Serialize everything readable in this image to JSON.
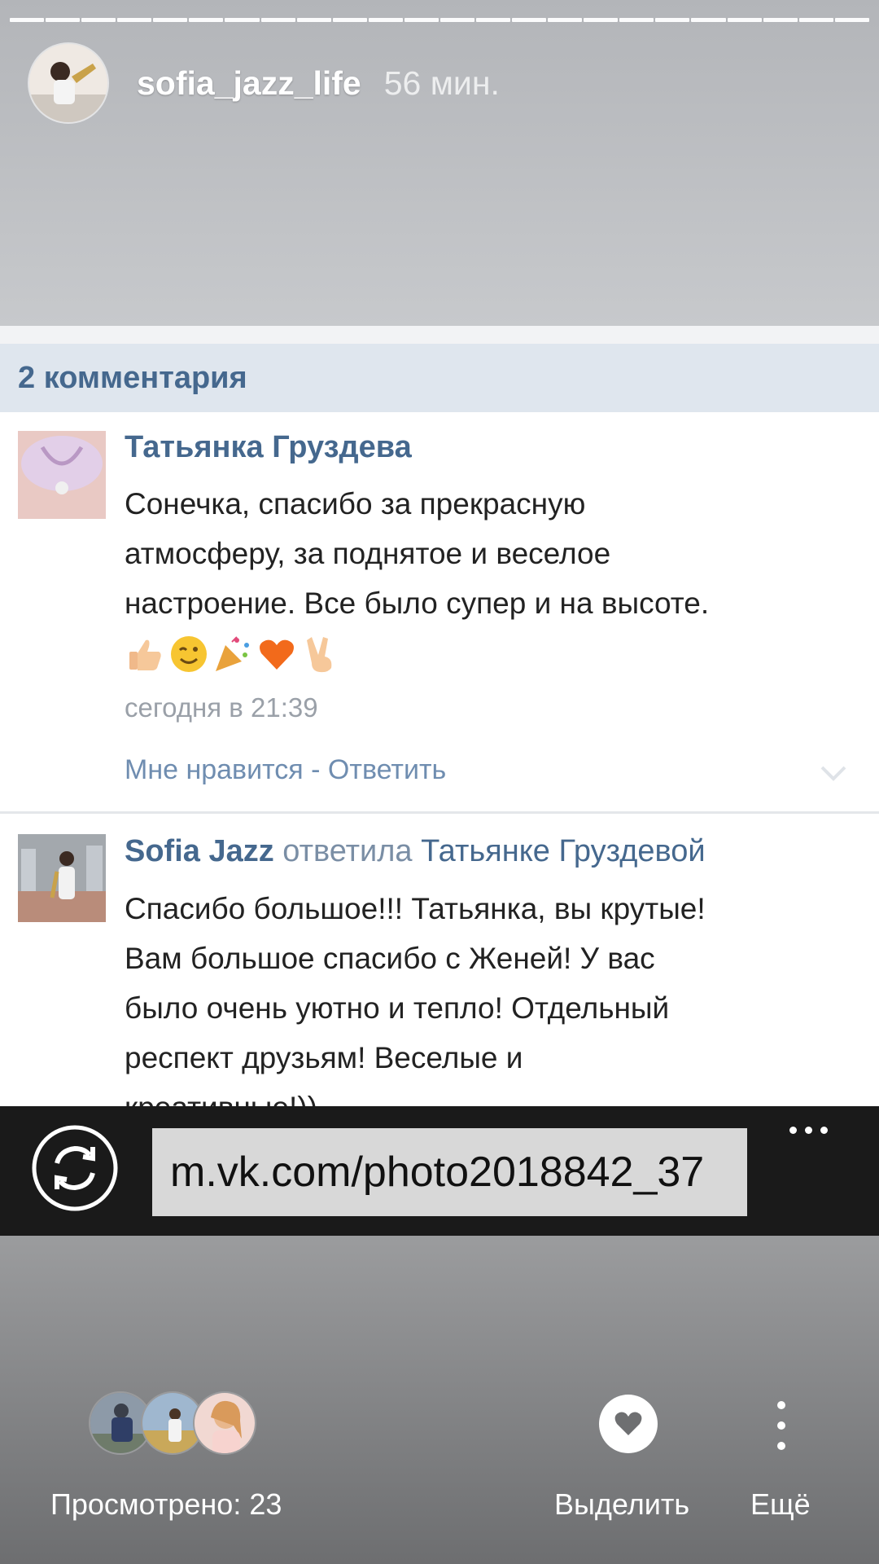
{
  "story": {
    "username": "sofia_jazz_life",
    "time_ago": "56 мин.",
    "progress_segments": 24,
    "progress_viewed": 24
  },
  "screenshot": {
    "comments_header": "2 комментария",
    "comments": [
      {
        "author": "Татьянка Груздева",
        "text_lines": [
          "Сонечка, спасибо за прекрасную",
          "атмосферу, за поднятое и веселое",
          "настроение. Все было супер и на высоте."
        ],
        "emojis": [
          "thumbs-up",
          "winking-face",
          "party-popper",
          "orange-heart",
          "victory-hand"
        ],
        "date": "сегодня в 21:39",
        "actions": "Мне нравится - Ответить"
      },
      {
        "author": "Sofia Jazz",
        "reply_verb": "ответила",
        "reply_to": "Татьянке Груздевой",
        "text_lines": [
          "Спасибо большое!!! Татьянка, вы крутые!",
          "Вам большое спасибо с Женей! У вас",
          "было очень уютно и тепло! Отдельный",
          "респект друзьям! Веселые и",
          "креативные!))"
        ]
      }
    ],
    "browser": {
      "url": "m.vk.com/photo2018842_37"
    }
  },
  "bottom": {
    "views_label": "Просмотрено: 23",
    "highlight_label": "Выделить",
    "more_label": "Ещё"
  },
  "colors": {
    "vk_link": "#45688e",
    "comments_header_bg": "#dfe6ee",
    "browser_bar": "#1a1a1a"
  }
}
